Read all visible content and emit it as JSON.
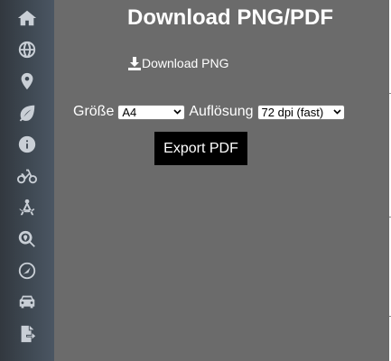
{
  "sidebar": {
    "items": [
      {
        "icon": "home-icon"
      },
      {
        "icon": "globe-icon"
      },
      {
        "icon": "map-marker-icon"
      },
      {
        "icon": "leaf-icon"
      },
      {
        "icon": "info-icon"
      },
      {
        "icon": "bicycle-icon"
      },
      {
        "icon": "drafting-compass-icon"
      },
      {
        "icon": "search-location-icon"
      },
      {
        "icon": "compass-icon"
      },
      {
        "icon": "car-icon"
      },
      {
        "icon": "file-export-icon"
      }
    ]
  },
  "panel": {
    "title": "Download PNG/PDF",
    "png_link": "Download PNG",
    "size_label": "Größe",
    "size_value": "A4",
    "resolution_label": "Auflösung",
    "resolution_value": "72 dpi (fast)",
    "export_button": "Export PDF"
  },
  "colors": {
    "panel_bg": "#6b6b6b",
    "sidebar_bg": "#3f4953",
    "sidebar_icon": "#c9cfd6",
    "button_bg": "#000000"
  }
}
